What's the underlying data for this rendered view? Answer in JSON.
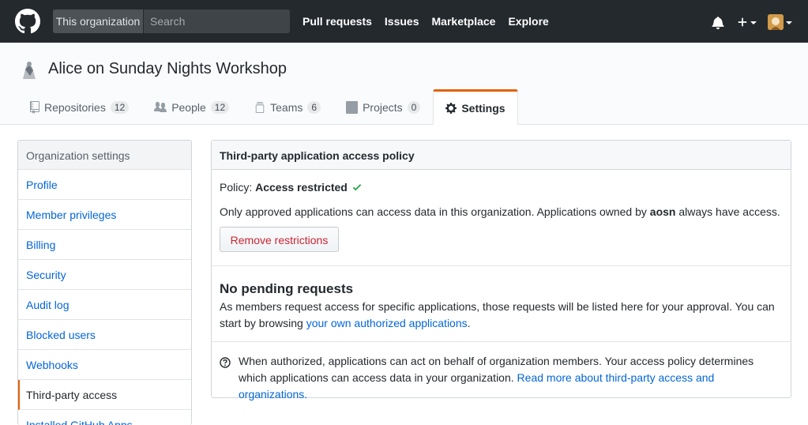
{
  "header": {
    "scope_label": "This organization",
    "search_placeholder": "Search",
    "nav": [
      "Pull requests",
      "Issues",
      "Marketplace",
      "Explore"
    ]
  },
  "org": {
    "name": "Alice on Sunday Nights Workshop",
    "tabs": [
      {
        "label": "Repositories",
        "count": "12",
        "icon": "repo-icon"
      },
      {
        "label": "People",
        "count": "12",
        "icon": "people-icon"
      },
      {
        "label": "Teams",
        "count": "6",
        "icon": "teams-icon"
      },
      {
        "label": "Projects",
        "count": "0",
        "icon": "project-icon"
      },
      {
        "label": "Settings",
        "icon": "gear-icon"
      }
    ]
  },
  "sidebar": {
    "heading": "Organization settings",
    "items": [
      "Profile",
      "Member privileges",
      "Billing",
      "Security",
      "Audit log",
      "Blocked users",
      "Webhooks",
      "Third-party access",
      "Installed GitHub Apps"
    ]
  },
  "main": {
    "title": "Third-party application access policy",
    "policy_label": "Policy:",
    "policy_value": "Access restricted",
    "desc_pre": "Only approved applications can access data in this organization. Applications owned by ",
    "desc_owner": "aosn",
    "desc_post": " always have access.",
    "remove_button": "Remove restrictions",
    "pending_title": "No pending requests",
    "pending_text_pre": "As members request access for specific applications, those requests will be listed here for your approval. You can start by browsing ",
    "pending_link": "your own authorized applications",
    "pending_text_post": ".",
    "note_pre": "When authorized, applications can act on behalf of organization members. Your access policy determines which applications can access data in your organization. ",
    "note_link": "Read more about third-party access and organizations.",
    "colors": {
      "accent": "#e36209",
      "danger": "#cb2431",
      "link": "#0366d6",
      "success": "#28a745"
    }
  }
}
